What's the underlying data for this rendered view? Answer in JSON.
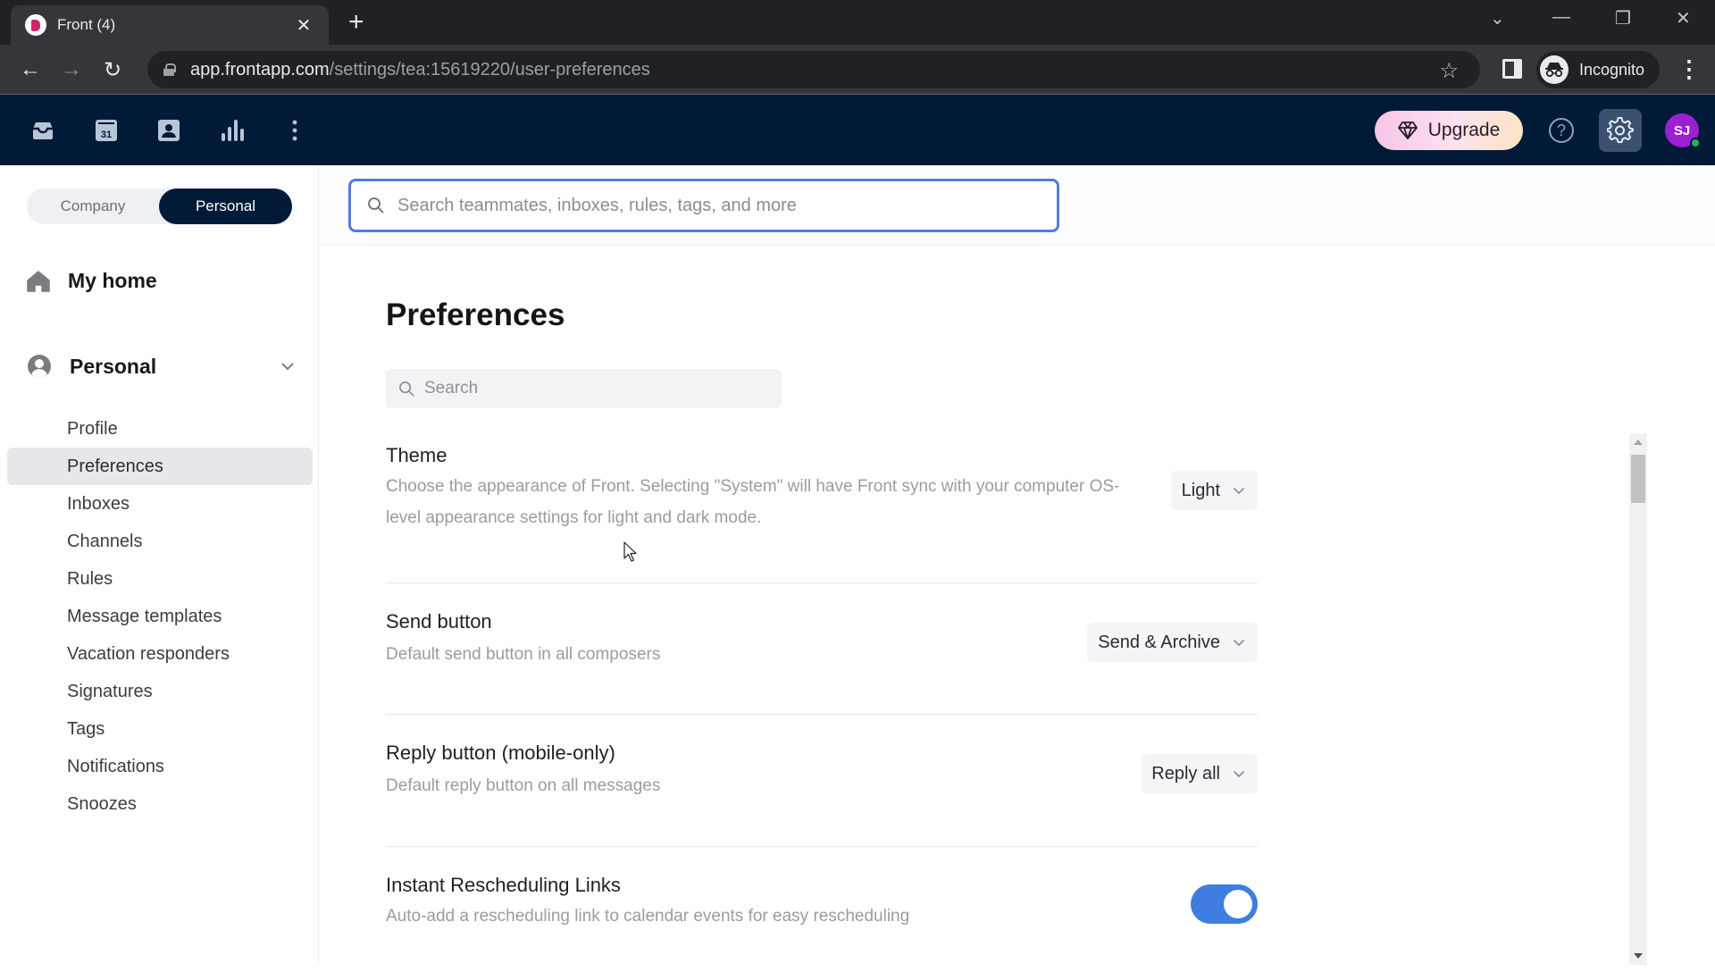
{
  "browser": {
    "tab_title": "Front (4)",
    "new_tab_label": "+",
    "url_host": "app.frontapp.com",
    "url_path": "/settings/tea:15619220/user-preferences",
    "profile_label": "Incognito"
  },
  "appnav": {
    "icons": [
      "inbox-icon",
      "calendar-icon",
      "contacts-icon",
      "analytics-icon",
      "more-icon"
    ],
    "calendar_day": "31",
    "upgrade_label": "Upgrade",
    "help_label": "?",
    "avatar_initials": "SJ",
    "colors": {
      "nav_bg": "#001a38",
      "avatar": "#9c1fd0",
      "online": "#21b35a"
    }
  },
  "sidebar": {
    "segment": {
      "company": "Company",
      "personal": "Personal",
      "selected": "Personal"
    },
    "home_label": "My home",
    "section_label": "Personal",
    "items": [
      {
        "label": "Profile",
        "active": false
      },
      {
        "label": "Preferences",
        "active": true
      },
      {
        "label": "Inboxes",
        "active": false
      },
      {
        "label": "Channels",
        "active": false
      },
      {
        "label": "Rules",
        "active": false
      },
      {
        "label": "Message templates",
        "active": false
      },
      {
        "label": "Vacation responders",
        "active": false
      },
      {
        "label": "Signatures",
        "active": false
      },
      {
        "label": "Tags",
        "active": false
      },
      {
        "label": "Notifications",
        "active": false
      },
      {
        "label": "Snoozes",
        "active": false
      }
    ]
  },
  "main": {
    "global_search_placeholder": "Search teammates, inboxes, rules, tags, and more",
    "title": "Preferences",
    "pref_search_placeholder": "Search",
    "settings": [
      {
        "title": "Theme",
        "description": "Choose the appearance of Front. Selecting \"System\" will have Front sync with your computer OS-level appearance settings for light and dark mode.",
        "control": "dropdown",
        "value": "Light"
      },
      {
        "title": "Send button",
        "description": "Default send button in all composers",
        "control": "dropdown",
        "value": "Send & Archive"
      },
      {
        "title": "Reply button (mobile-only)",
        "description": "Default reply button on all messages",
        "control": "dropdown",
        "value": "Reply all"
      },
      {
        "title": "Instant Rescheduling Links",
        "description": "Auto-add a rescheduling link to calendar events for easy rescheduling",
        "control": "toggle",
        "value": true
      }
    ],
    "accent_color": "#3f7ee0"
  }
}
